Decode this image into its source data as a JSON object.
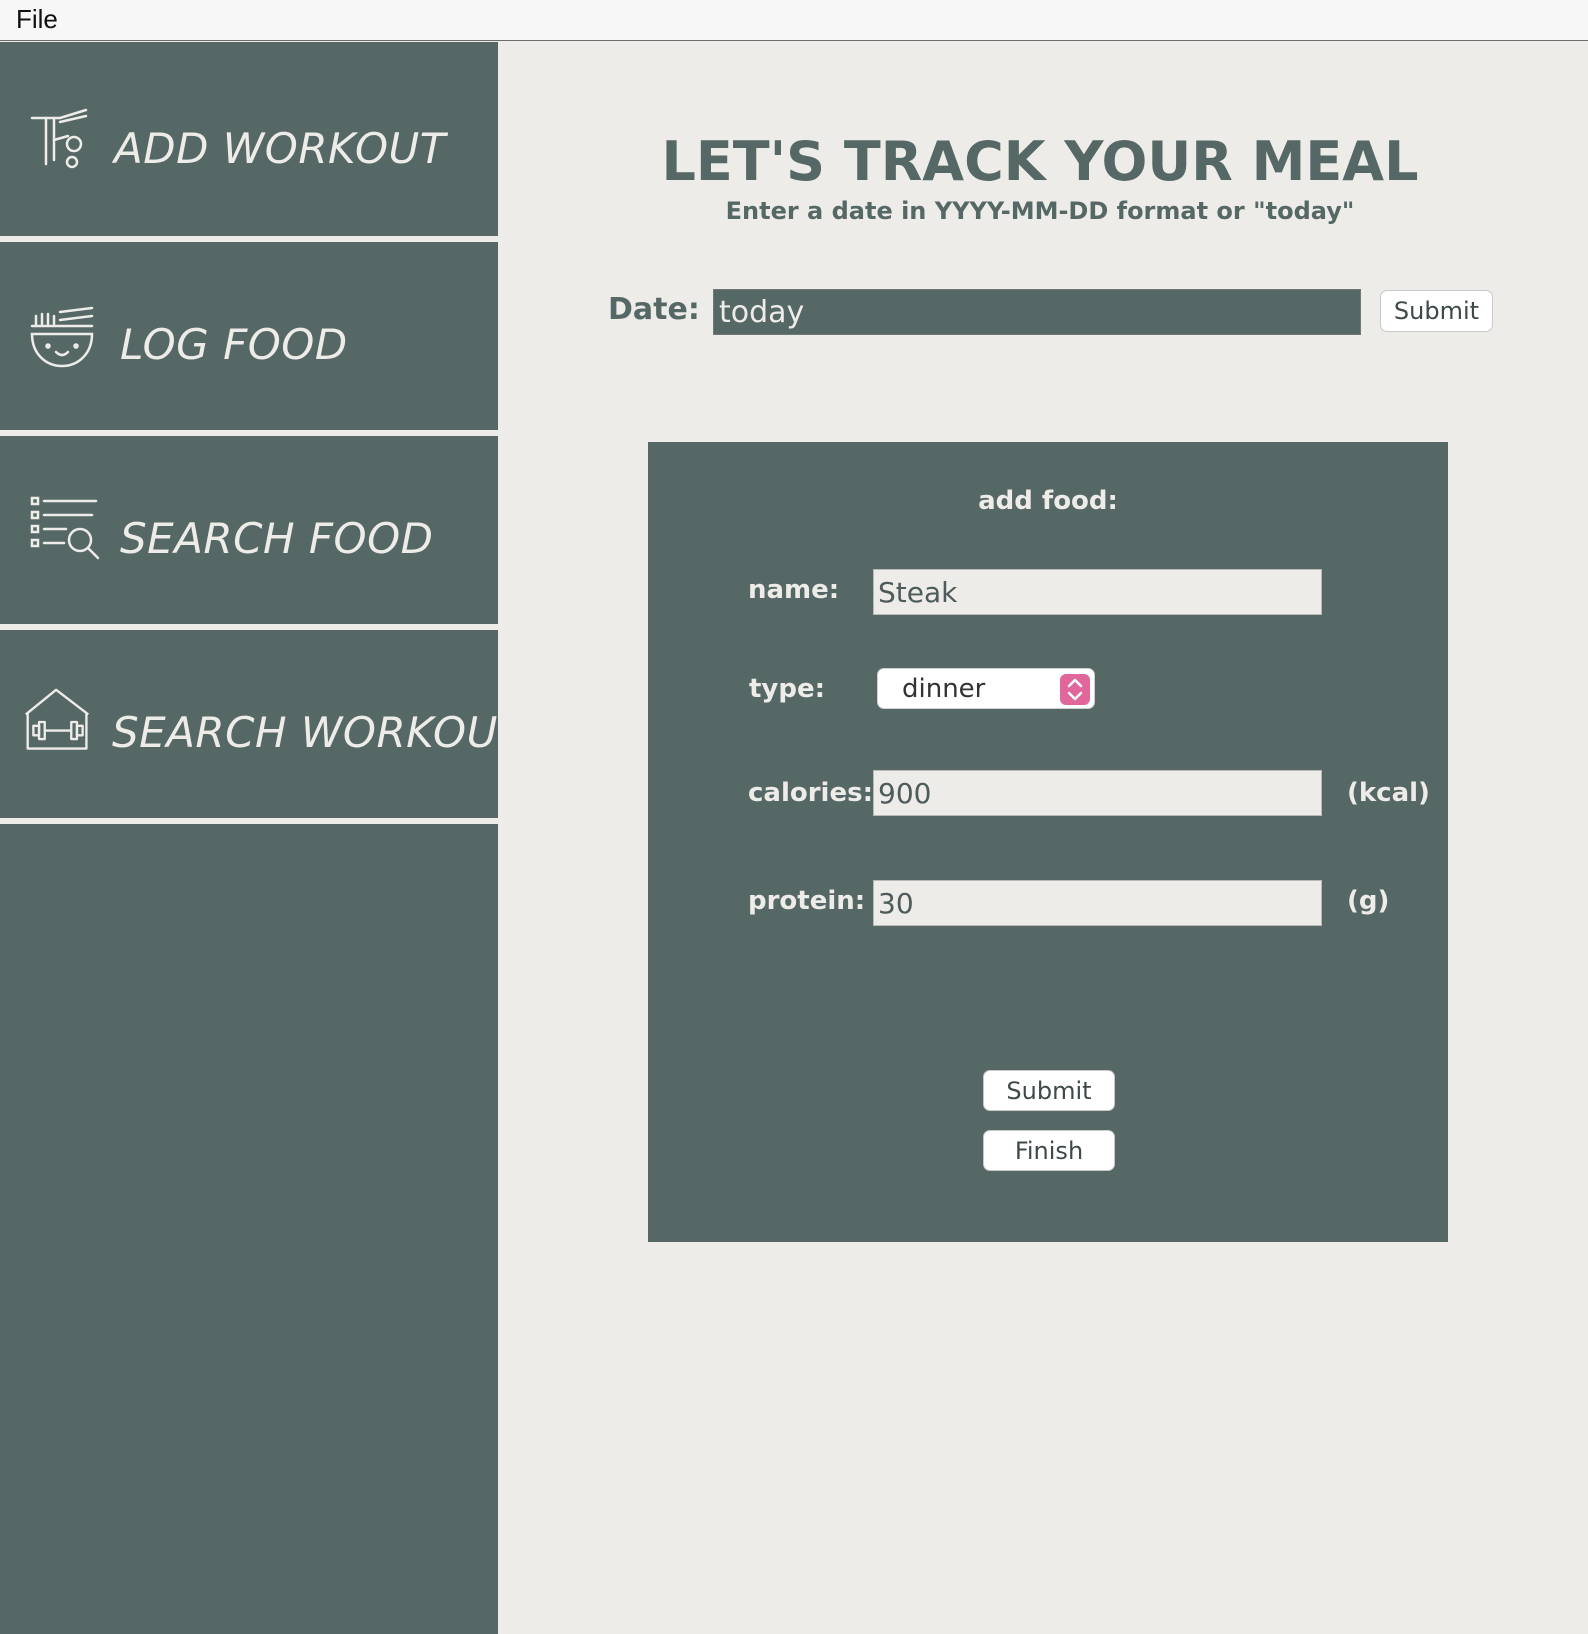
{
  "menubar": {
    "file_label": "File"
  },
  "sidebar": {
    "items": [
      {
        "label": "ADD WORKOUT",
        "icon": "workout-add-icon"
      },
      {
        "label": "LOG FOOD",
        "icon": "noodle-bowl-icon"
      },
      {
        "label": "SEARCH FOOD",
        "icon": "list-search-icon"
      },
      {
        "label": "SEARCH WORKOUT",
        "icon": "gym-house-icon"
      }
    ]
  },
  "main": {
    "title": "LET'S TRACK YOUR MEAL",
    "subtitle": "Enter a date in YYYY-MM-DD format or \"today\"",
    "date_label": "Date:",
    "date_value": "today",
    "date_submit": "Submit"
  },
  "form": {
    "title": "add food:",
    "name_label": "name:",
    "name_value": "Steak",
    "type_label": "type:",
    "type_value": "dinner",
    "calories_label": "calories:",
    "calories_value": "900",
    "calories_unit": "(kcal)",
    "protein_label": "protein:",
    "protein_value": "30",
    "protein_unit": "(g)",
    "submit_label": "Submit",
    "finish_label": "Finish"
  },
  "colors": {
    "sidebar_bg": "#566866",
    "page_bg": "#edece8",
    "select_accent": "#e0669c"
  }
}
